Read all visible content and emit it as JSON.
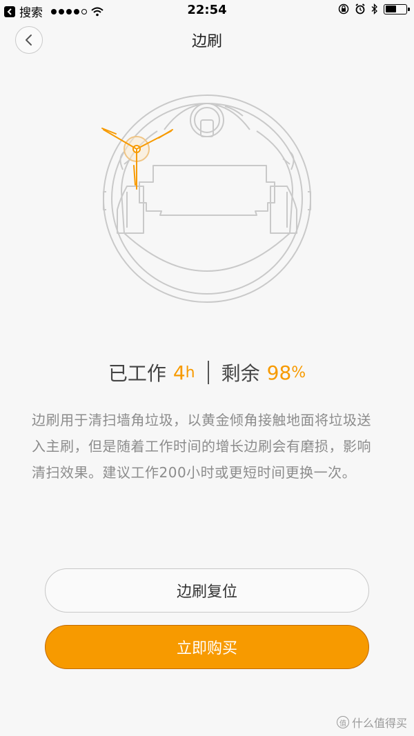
{
  "status_bar": {
    "carrier": "搜索",
    "time": "22:54",
    "icons": [
      "back-app-icon",
      "signal-dots-icon",
      "wifi-icon",
      "orientation-lock-icon",
      "alarm-icon",
      "bluetooth-icon",
      "battery-icon"
    ]
  },
  "nav": {
    "title": "边刷",
    "back_icon": "chevron-left-icon"
  },
  "illustration": {
    "subject": "robot-vacuum-side-brush",
    "accent_color": "#f79a00",
    "line_color": "#c9c9c9"
  },
  "stats": {
    "worked_label": "已工作",
    "worked_value": "4",
    "worked_unit": "h",
    "remaining_label": "剩余",
    "remaining_value": "98",
    "remaining_unit": "%"
  },
  "description": "边刷用于清扫墙角垃圾，以黄金倾角接触地面将垃圾送入主刷，但是随着工作时间的增长边刷会有磨损，影响清扫效果。建议工作200小时或更短时间更换一次。",
  "buttons": {
    "reset_label": "边刷复位",
    "buy_label": "立即购买"
  },
  "colors": {
    "accent": "#f79a00",
    "background": "#f7f7f7",
    "text_muted": "#8c8c8c"
  },
  "watermark": {
    "badge": "值",
    "text": "什么值得买"
  }
}
